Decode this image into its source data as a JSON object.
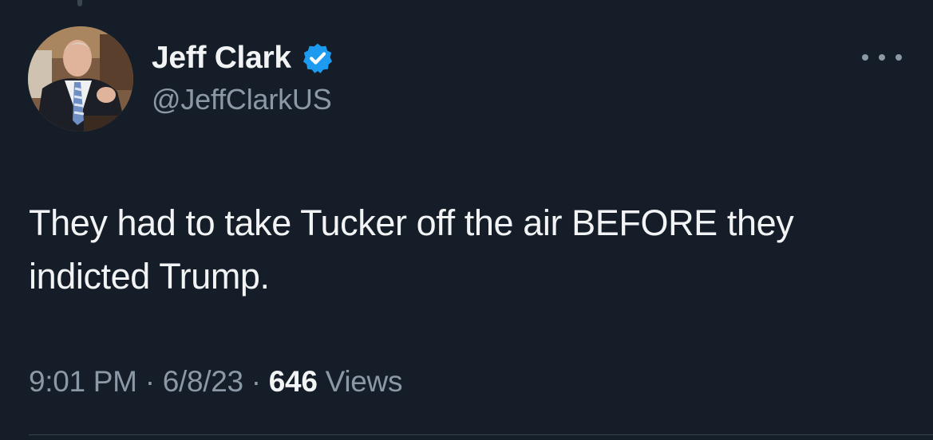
{
  "tweet": {
    "author": {
      "display_name": "Jeff Clark",
      "handle": "@JeffClarkUS",
      "verified_icon": "verified-badge-icon",
      "avatar": "avatar-photo"
    },
    "text": "They had to take Tucker off the air BEFORE they indicted Trump.",
    "time": "9:01 PM",
    "date": "6/8/23",
    "separator": "·",
    "views_count": "646",
    "views_label": "Views",
    "more_icon": "more-options-icon"
  },
  "colors": {
    "background": "#151d28",
    "text_primary": "#f2f3f4",
    "text_secondary": "#8b98a5",
    "verified_blue": "#1d9bf0",
    "divider": "#38444d"
  }
}
